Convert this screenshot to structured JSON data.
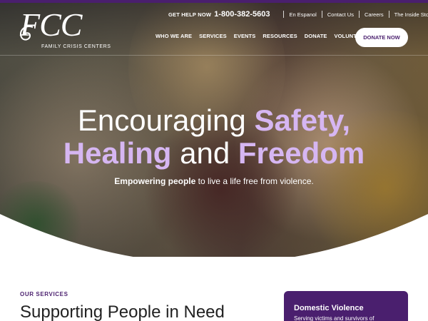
{
  "brand": {
    "logo_mark": "FCC",
    "logo_sub": "FAMILY CRISIS CENTERS"
  },
  "utility": {
    "help_label": "GET HELP NOW",
    "help_phone": "1-800-382-5603",
    "links": [
      "En Espanol",
      "Contact Us",
      "Careers",
      "The Inside Story"
    ]
  },
  "nav": {
    "items": [
      "WHO WE ARE",
      "SERVICES",
      "EVENTS",
      "RESOURCES",
      "DONATE",
      "VOLUNTEER"
    ],
    "cta": "DONATE NOW"
  },
  "hero": {
    "line1_light": "Encouraging ",
    "line1_accent": "Safety,",
    "line2_accent_a": "Healing",
    "line2_light": " and ",
    "line2_accent_b": "Freedom",
    "tagline_strong": "Empowering people",
    "tagline_rest": " to live a life free from violence."
  },
  "services": {
    "label": "OUR SERVICES",
    "title": "Supporting People in Need"
  },
  "card": {
    "title": "Domestic Violence",
    "text": "Serving victims and survivors of"
  },
  "colors": {
    "brand_purple": "#4a1f6e",
    "accent_lavender": "#d6b6f2"
  }
}
